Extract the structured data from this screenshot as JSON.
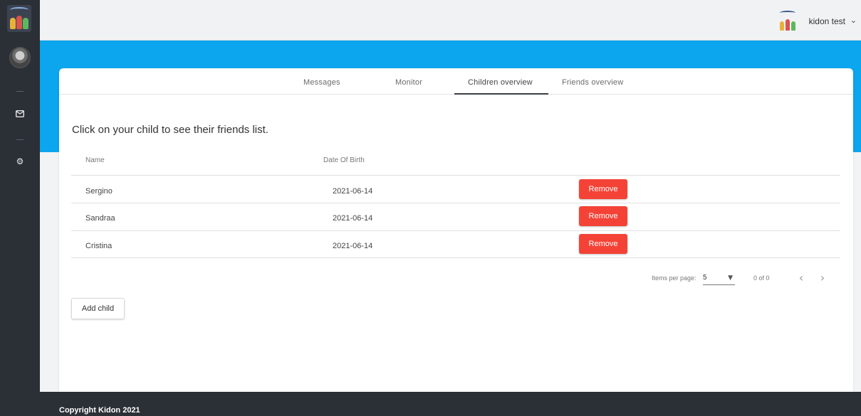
{
  "header": {
    "user_name": "kidon test",
    "caret": "⌄"
  },
  "sidebar": {
    "icons": [
      {
        "name": "mail-icon",
        "glyph": "✉"
      },
      {
        "name": "gear-icon",
        "glyph": "⚙"
      }
    ]
  },
  "tabs": [
    {
      "label": "Messages"
    },
    {
      "label": "Monitor"
    },
    {
      "label": "Children overview",
      "active": true
    },
    {
      "label": "Friends overview"
    }
  ],
  "instruction": "Click on your child to see their friends list.",
  "table": {
    "columns": {
      "name": "Name",
      "dob": "Date Of Birth"
    },
    "rows": [
      {
        "name": "Sergino",
        "dob": "2021-06-14",
        "action": "Remove"
      },
      {
        "name": "Sandraa",
        "dob": "2021-06-14",
        "action": "Remove"
      },
      {
        "name": "Cristina",
        "dob": "2021-06-14",
        "action": "Remove"
      }
    ]
  },
  "paginator": {
    "label": "Items per page:",
    "page_size": "5",
    "range": "0 of 0",
    "prev": "‹",
    "next": "›"
  },
  "add_child_label": "Add child",
  "footer": {
    "copyright": "Copyright Kidon 2021"
  },
  "colors": {
    "primary_blue": "#0ba6ee",
    "danger_red": "#f44336",
    "sidebar_dark": "#2b2f36"
  }
}
